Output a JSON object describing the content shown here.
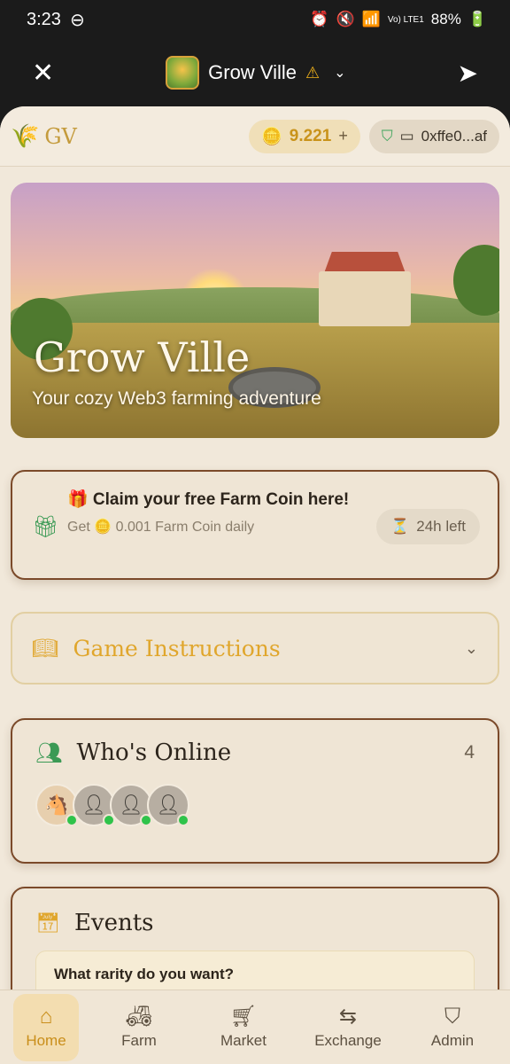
{
  "status": {
    "time": "3:23",
    "battery": "88%",
    "network": "Vo) LTE1"
  },
  "header": {
    "title": "Grow Ville",
    "avatar_text": "Grow Ville"
  },
  "topbar": {
    "logo": "GV",
    "coins": "9.221",
    "plus": "+",
    "wallet": "0xffe0...af"
  },
  "hero": {
    "title": "Grow Ville",
    "subtitle": "Your cozy Web3 farming adventure"
  },
  "claim": {
    "title": "🎁 Claim your free Farm Coin here!",
    "subtitle": "Get 🪙 0.001 Farm Coin daily",
    "timer": "24h left"
  },
  "instructions": {
    "label": "Game Instructions"
  },
  "online": {
    "title": "Who's Online",
    "count": "4"
  },
  "events": {
    "title": "Events",
    "first_item": "What rarity do you want?"
  },
  "nav": {
    "home": "Home",
    "farm": "Farm",
    "market": "Market",
    "exchange": "Exchange",
    "admin": "Admin"
  },
  "colors": {
    "accent": "#e0a62c",
    "green": "#3b9a55",
    "card_border": "#7b4a2a",
    "background": "#f1e8da"
  }
}
